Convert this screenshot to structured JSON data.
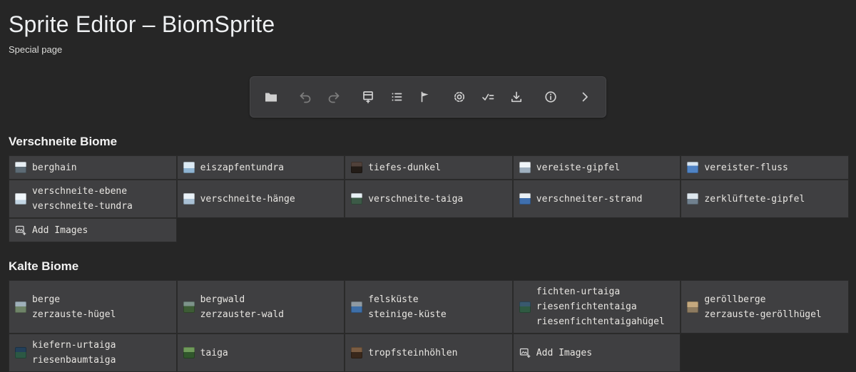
{
  "page": {
    "title": "Sprite Editor – BiomSprite",
    "subtitle": "Special page"
  },
  "toolbar": {
    "icons": [
      "folder",
      "undo",
      "redo",
      "insert-image",
      "list",
      "flag",
      "settings",
      "validate",
      "download",
      "info",
      "expand"
    ]
  },
  "colors": {
    "page_background": "#262626",
    "toolbar_background": "#3a3a3c",
    "cell_background": "#3f3f41",
    "cell_border": "#2a2a2a",
    "text": "#e8e6e2"
  },
  "sections": [
    {
      "title": "Verschneite Biome",
      "rows": [
        {
          "cells": [
            {
              "lines": [
                "berghain"
              ]
            },
            {
              "lines": [
                "eiszapfentundra"
              ]
            },
            {
              "lines": [
                "tiefes-dunkel"
              ]
            },
            {
              "lines": [
                "vereiste-gipfel"
              ]
            },
            {
              "lines": [
                "vereister-fluss"
              ]
            }
          ]
        },
        {
          "cells": [
            {
              "lines": [
                "verschneite-ebene",
                "verschneite-tundra"
              ]
            },
            {
              "lines": [
                "verschneite-hänge"
              ]
            },
            {
              "lines": [
                "verschneite-taiga"
              ]
            },
            {
              "lines": [
                "verschneiter-strand"
              ]
            },
            {
              "lines": [
                "zerklüftete-gipfel"
              ]
            }
          ]
        },
        {
          "cells": [
            {
              "label": "Add Images"
            }
          ]
        }
      ]
    },
    {
      "title": "Kalte Biome",
      "rows": [
        {
          "cells": [
            {
              "lines": [
                "berge",
                "zerzauste-hügel"
              ]
            },
            {
              "lines": [
                "bergwald",
                "zerzauster-wald"
              ]
            },
            {
              "lines": [
                "felsküste",
                "steinige-küste"
              ]
            },
            {
              "lines": [
                "fichten-urtaiga",
                "riesenfichtentaiga",
                "riesenfichtentaigahügel"
              ]
            },
            {
              "lines": [
                "geröllberge",
                "zerzauste-geröllhügel"
              ]
            }
          ]
        },
        {
          "cells": [
            {
              "lines": [
                "kiefern-urtaiga",
                "riesenbaumtaiga"
              ]
            },
            {
              "lines": [
                "taiga"
              ]
            },
            {
              "lines": [
                "tropfsteinhöhlen"
              ]
            },
            {
              "label": "Add Images"
            }
          ]
        }
      ]
    }
  ]
}
